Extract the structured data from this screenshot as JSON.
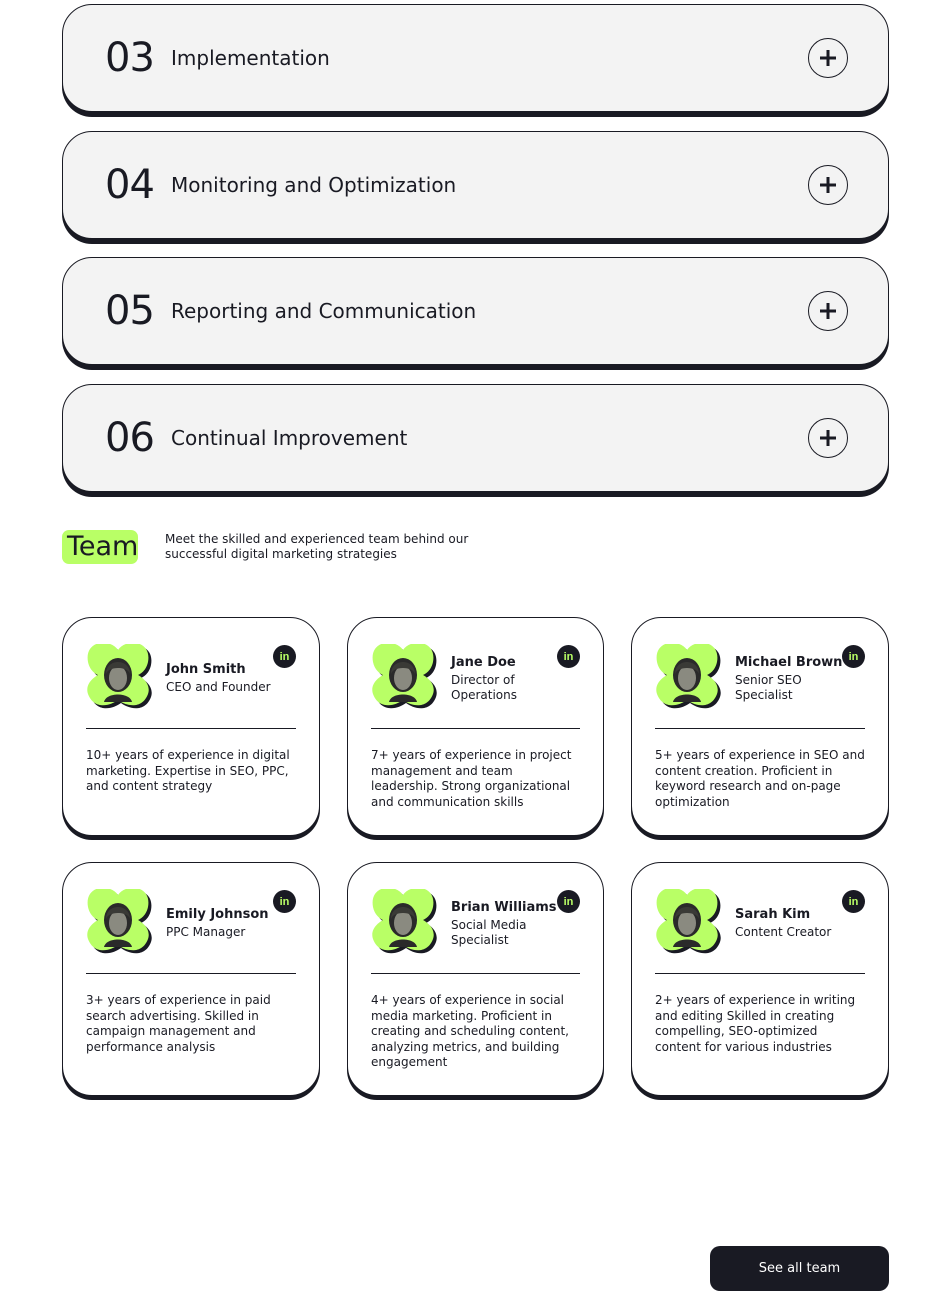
{
  "process": {
    "items": [
      {
        "number": "03",
        "title": "Implementation"
      },
      {
        "number": "04",
        "title": "Monitoring and Optimization"
      },
      {
        "number": "05",
        "title": "Reporting and Communication"
      },
      {
        "number": "06",
        "title": "Continual Improvement"
      }
    ],
    "expand_icon": "plus-icon"
  },
  "team": {
    "heading": "Team",
    "description": "Meet the skilled and experienced team behind our successful digital marketing strategies",
    "accent_color": "#b9ff66",
    "dark_color": "#191a23",
    "linkedin_label": "in",
    "members": [
      {
        "name": "John Smith",
        "role": "CEO and Founder",
        "bio": "10+ years of experience in digital marketing. Expertise in SEO, PPC, and content strategy"
      },
      {
        "name": "Jane Doe",
        "role": "Director of Operations",
        "bio": "7+ years of experience in project management and team leadership. Strong organizational and communication skills"
      },
      {
        "name": "Michael Brown",
        "role": "Senior SEO Specialist",
        "bio": "5+ years of experience in SEO and content creation. Proficient in keyword research and on-page optimization"
      },
      {
        "name": "Emily Johnson",
        "role": "PPC Manager",
        "bio": "3+ years of experience in paid search advertising. Skilled in campaign management and performance analysis"
      },
      {
        "name": "Brian Williams",
        "role": "Social Media Specialist",
        "bio": "4+ years of experience in social media marketing. Proficient in creating and scheduling content, analyzing metrics, and building engagement"
      },
      {
        "name": "Sarah Kim",
        "role": "Content Creator",
        "bio": "2+ years of experience in writing and editing Skilled in creating compelling, SEO-optimized content for various industries"
      }
    ],
    "see_all_label": "See all team"
  }
}
